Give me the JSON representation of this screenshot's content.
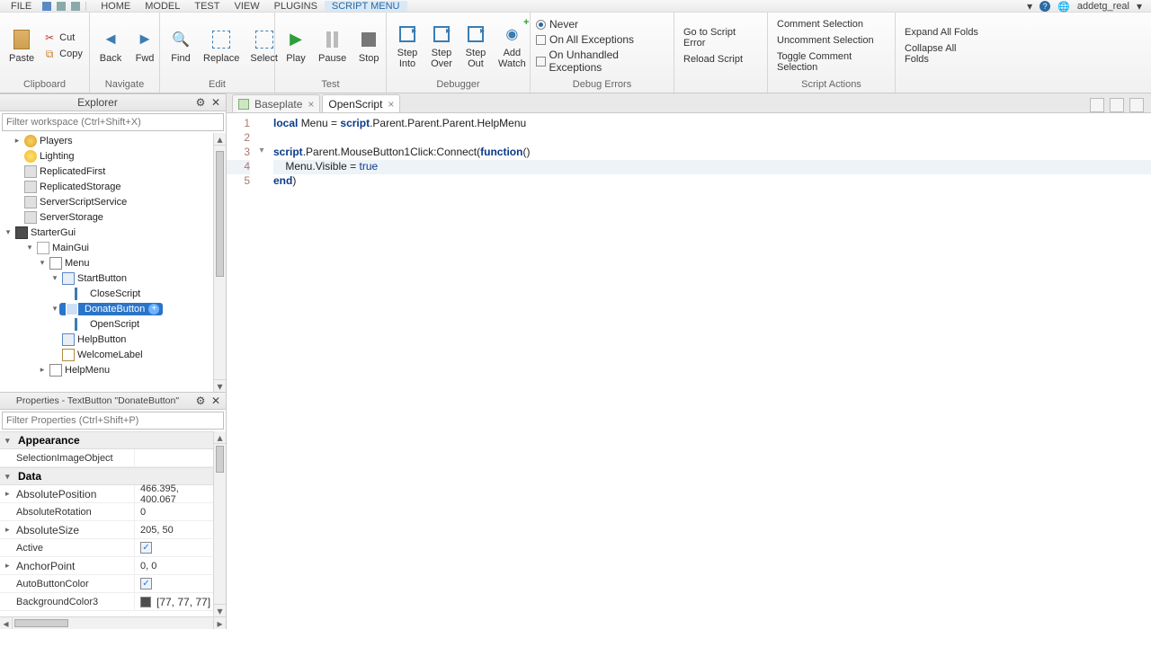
{
  "user": "addetg_real",
  "menubar": {
    "file": "FILE",
    "home": "HOME",
    "model": "MODEL",
    "test": "TEST",
    "view": "VIEW",
    "plugins": "PLUGINS",
    "script": "SCRIPT MENU"
  },
  "ribbon": {
    "clipboard": {
      "title": "Clipboard",
      "paste": "Paste",
      "cut": "Cut",
      "copy": "Copy"
    },
    "navigate": {
      "title": "Navigate",
      "back": "Back",
      "fwd": "Fwd"
    },
    "edit": {
      "title": "Edit",
      "find": "Find",
      "replace": "Replace",
      "select": "Select"
    },
    "test": {
      "title": "Test",
      "play": "Play",
      "pause": "Pause",
      "stop": "Stop"
    },
    "debugger": {
      "title": "Debugger",
      "stepinto": "Step\nInto",
      "stepover": "Step\nOver",
      "stepout": "Step\nOut",
      "addwatch": "Add\nWatch"
    },
    "debugerrors": {
      "title": "Debug Errors",
      "never": "Never",
      "onall": "On All Exceptions",
      "onunh": "On Unhandled Exceptions"
    },
    "debugactions": {
      "gotoerror": "Go to Script Error",
      "reload": "Reload Script"
    },
    "scriptactions": {
      "title": "Script Actions",
      "comment": "Comment Selection",
      "uncomment": "Uncomment Selection",
      "toggle": "Toggle Comment Selection",
      "expand": "Expand All Folds",
      "collapse": "Collapse All Folds"
    }
  },
  "explorer": {
    "title": "Explorer",
    "filter_ph": "Filter workspace (Ctrl+Shift+X)",
    "items": {
      "players": "Players",
      "lighting": "Lighting",
      "repfirst": "ReplicatedFirst",
      "repstore": "ReplicatedStorage",
      "sss": "ServerScriptService",
      "sstore": "ServerStorage",
      "sgui": "StarterGui",
      "maingui": "MainGui",
      "menu": "Menu",
      "startbtn": "StartButton",
      "closescript": "CloseScript",
      "donatebtn": "DonateButton",
      "openscript": "OpenScript",
      "helpbtn": "HelpButton",
      "welcome": "WelcomeLabel",
      "helpmenu": "HelpMenu"
    }
  },
  "properties": {
    "title": "Properties - TextButton \"DonateButton\"",
    "filter_ph": "Filter Properties (Ctrl+Shift+P)",
    "cat_appearance": "Appearance",
    "cat_data": "Data",
    "rows": {
      "selimg": {
        "k": "SelectionImageObject",
        "v": ""
      },
      "abspos": {
        "k": "AbsolutePosition",
        "v": "466.395, 400.067"
      },
      "absrot": {
        "k": "AbsoluteRotation",
        "v": "0"
      },
      "abssize": {
        "k": "AbsoluteSize",
        "v": "205, 50"
      },
      "active": {
        "k": "Active",
        "v": true
      },
      "anchor": {
        "k": "AnchorPoint",
        "v": "0, 0"
      },
      "autocolor": {
        "k": "AutoButtonColor",
        "v": true
      },
      "bgcolor": {
        "k": "BackgroundColor3",
        "v": "[77, 77, 77]"
      }
    }
  },
  "tabs": {
    "baseplate": "Baseplate",
    "openscript": "OpenScript"
  },
  "code": {
    "l1": {
      "kw": "local ",
      "a": "Menu = ",
      "b": "script",
      "c": ".Parent.Parent.Parent.HelpMenu"
    },
    "l3": {
      "a": "script",
      "b": ".Parent.MouseButton1Click:Connect(",
      "c": "function",
      "d": "()"
    },
    "l4": {
      "a": "    Menu.Visible = ",
      "b": "true"
    },
    "l5": {
      "a": "end",
      "b": ")"
    }
  }
}
